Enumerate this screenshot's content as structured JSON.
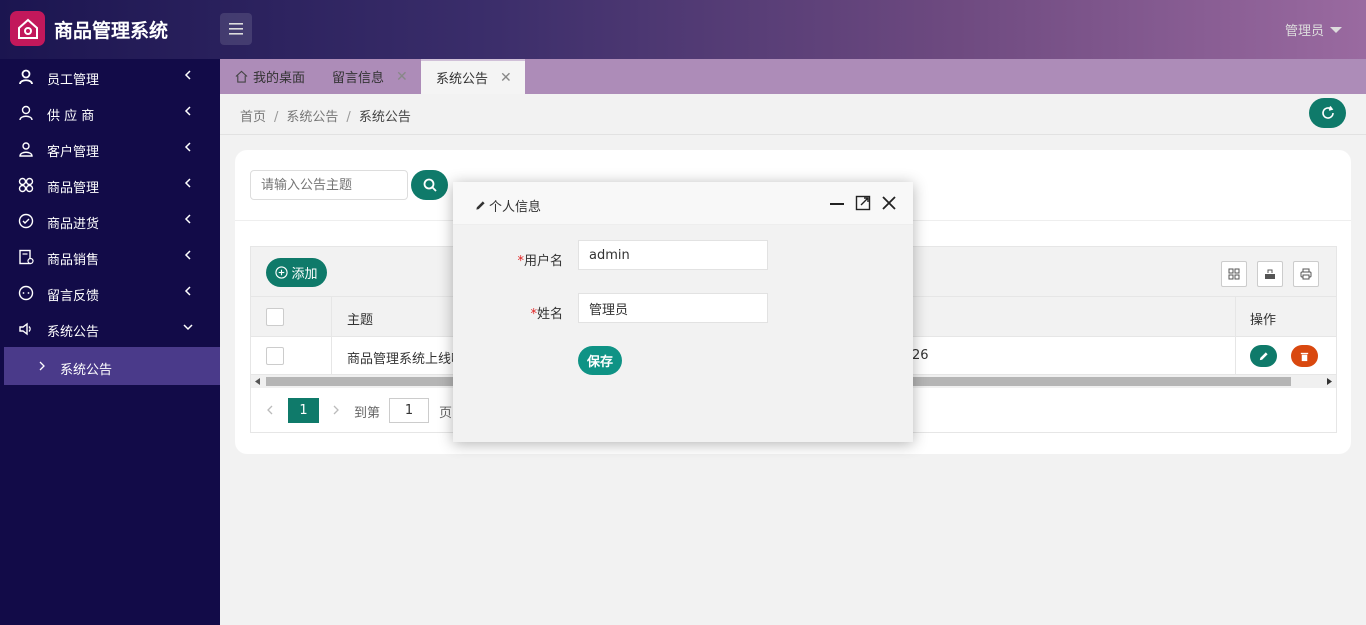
{
  "app": {
    "title": "商品管理系统",
    "user": "管理员"
  },
  "sidebar": {
    "items": [
      {
        "label": "员工管理",
        "icon": "user-bold-icon"
      },
      {
        "label": "供 应 商",
        "icon": "user-icon"
      },
      {
        "label": "客户管理",
        "icon": "users-icon"
      },
      {
        "label": "商品管理",
        "icon": "app-grid-icon"
      },
      {
        "label": "商品进货",
        "icon": "check-circle-icon"
      },
      {
        "label": "商品销售",
        "icon": "receipt-icon"
      },
      {
        "label": "留言反馈",
        "icon": "chat-icon"
      },
      {
        "label": "系统公告",
        "icon": "speaker-icon"
      }
    ],
    "sub_item": "系统公告"
  },
  "tabs": [
    {
      "label": "我的桌面"
    },
    {
      "label": "留言信息"
    },
    {
      "label": "系统公告"
    }
  ],
  "breadcrumb": {
    "home": "首页",
    "parent": "系统公告",
    "current": "系统公告"
  },
  "search": {
    "placeholder": "请输入公告主题"
  },
  "toolbar": {
    "add_label": "添加"
  },
  "table": {
    "headers": {
      "subject": "主题",
      "actions": "操作"
    },
    "row": {
      "subject": "商品管理系统上线啦",
      "date_tail": "26"
    }
  },
  "pager": {
    "current": "1",
    "goto": "到第",
    "input": "1",
    "page": "页"
  },
  "modal": {
    "title": "个人信息",
    "username_label": "用户名",
    "username_value": "admin",
    "name_label": "姓名",
    "name_value": "管理员",
    "save_label": "保存",
    "required_mark": "*"
  },
  "colors": {
    "accent": "#0f7a6a",
    "sidebar": "#120b48",
    "danger": "#d9480f"
  }
}
